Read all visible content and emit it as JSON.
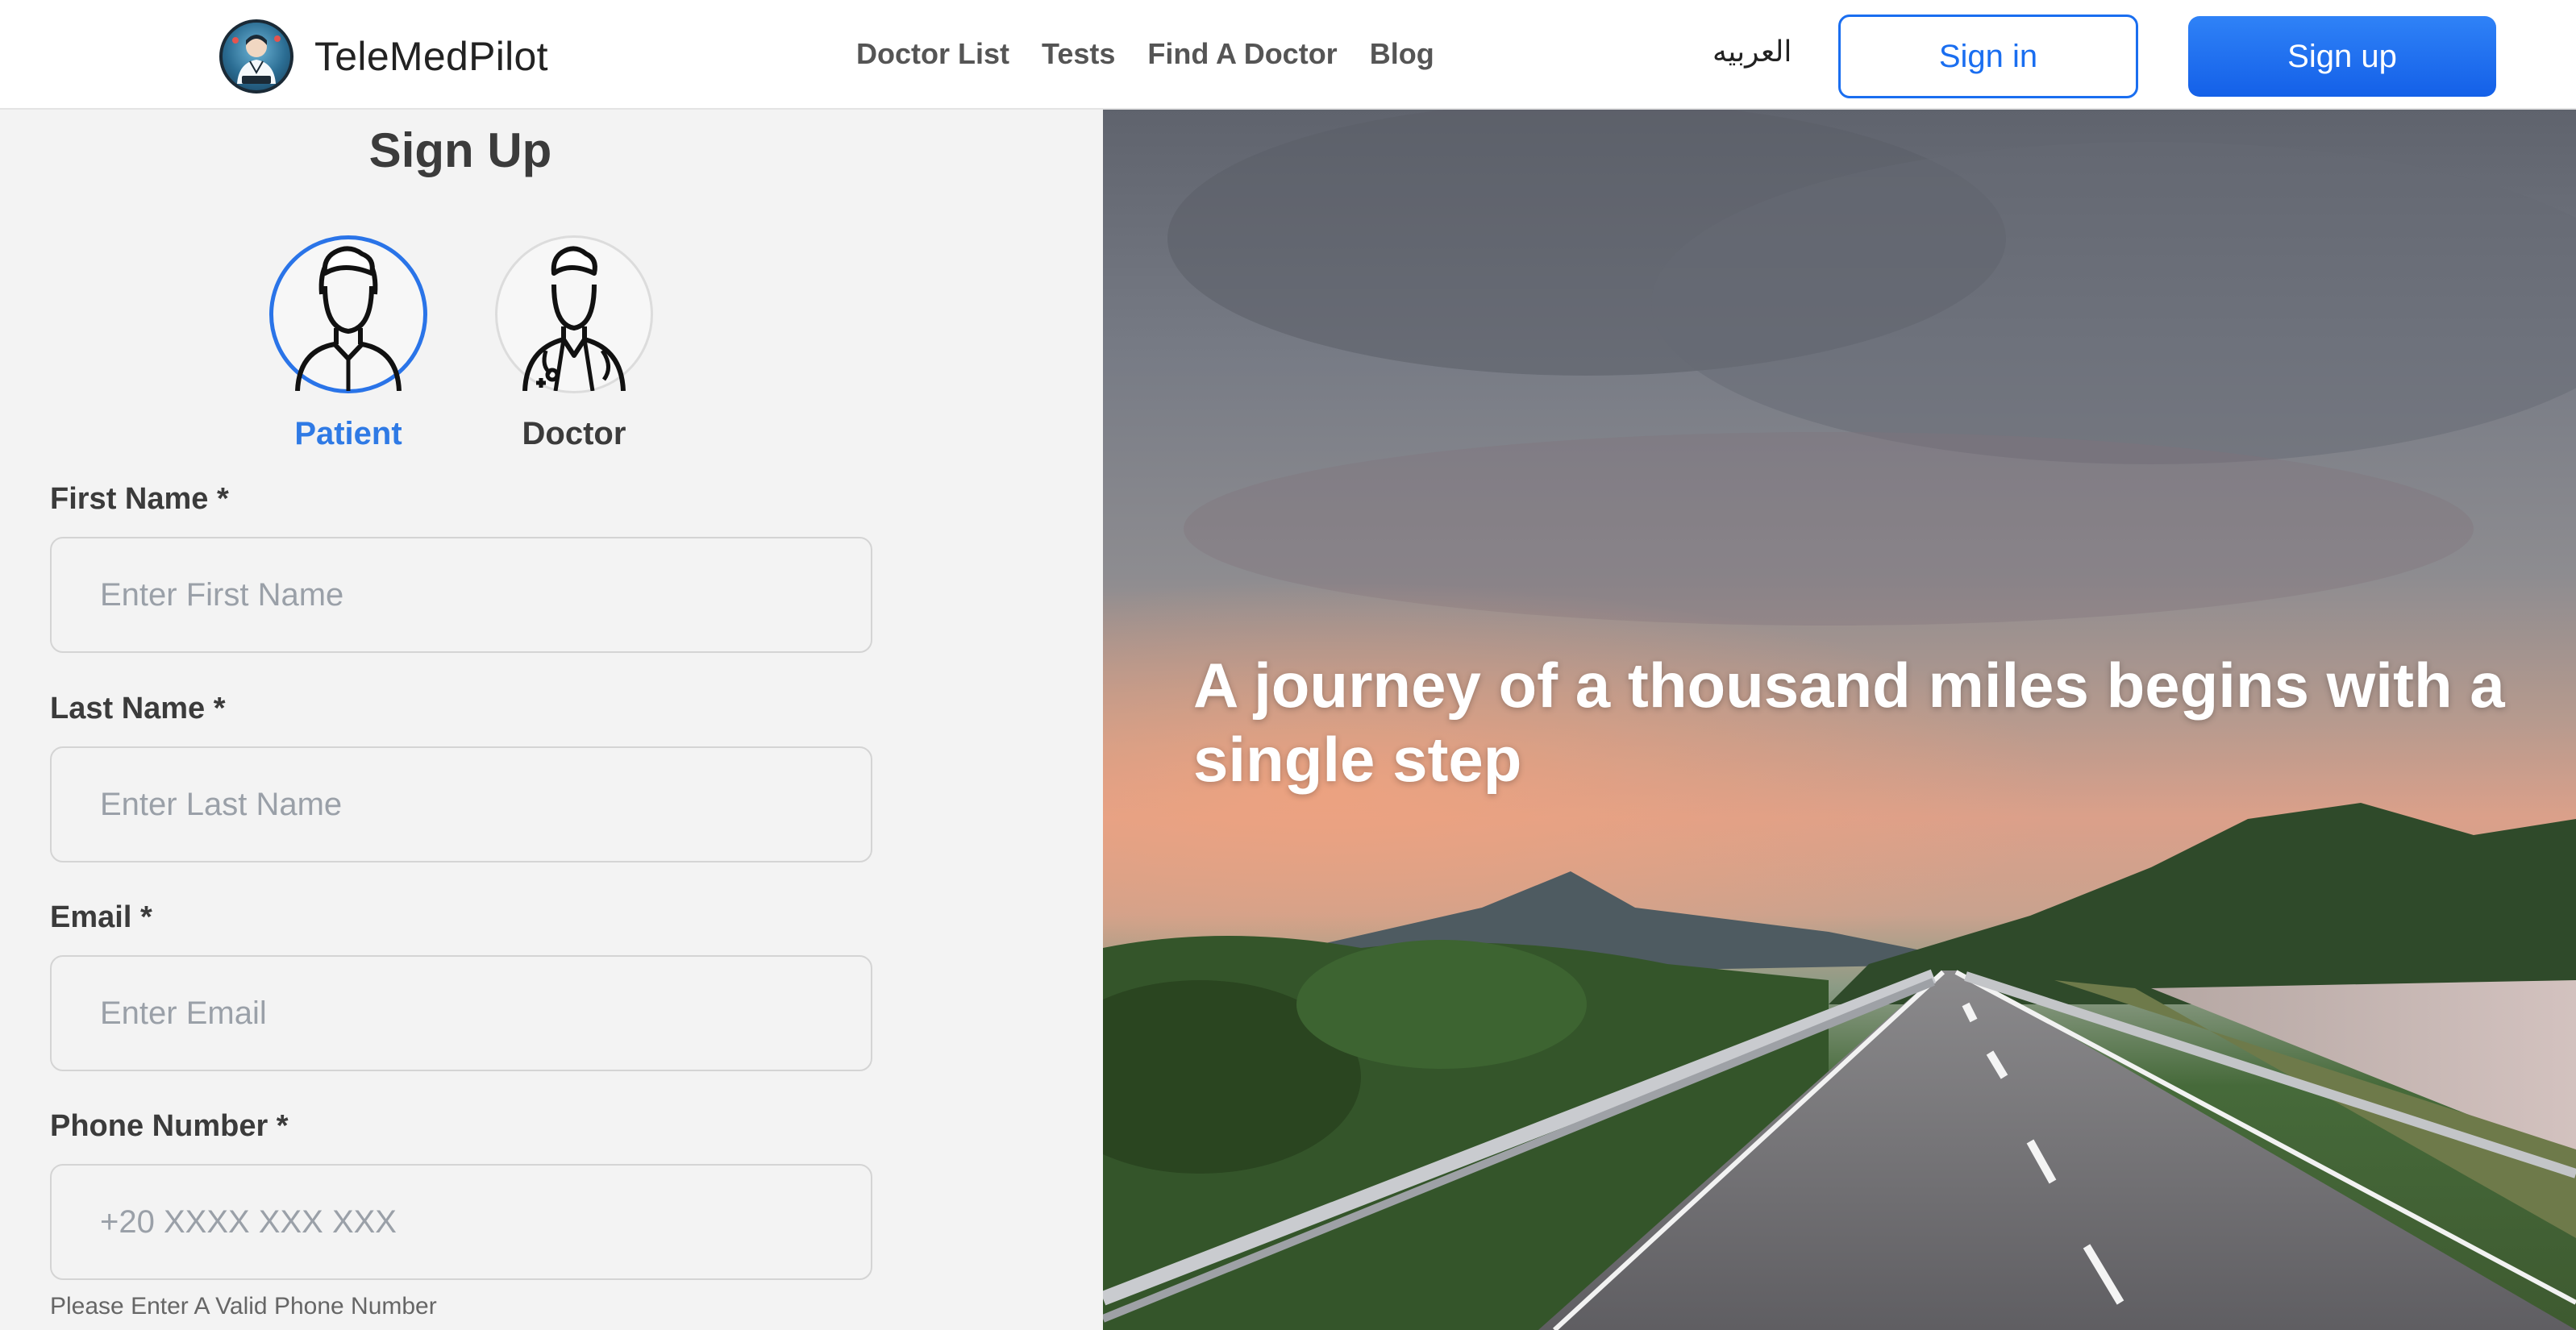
{
  "header": {
    "brand": "TeleMedPilot",
    "nav": [
      "Doctor List",
      "Tests",
      "Find A Doctor",
      "Blog"
    ],
    "language_toggle": "العربيه",
    "signin_label": "Sign in",
    "signup_label": "Sign up"
  },
  "form": {
    "title": "Sign Up",
    "roles": [
      {
        "label": "Patient",
        "icon": "patient-avatar-icon",
        "selected": true
      },
      {
        "label": "Doctor",
        "icon": "doctor-avatar-icon",
        "selected": false
      }
    ],
    "fields": [
      {
        "label": "First Name *",
        "placeholder": "Enter First Name",
        "value": ""
      },
      {
        "label": "Last Name *",
        "placeholder": "Enter Last Name",
        "value": ""
      },
      {
        "label": "Email *",
        "placeholder": "Enter Email",
        "value": ""
      },
      {
        "label": "Phone Number *",
        "placeholder": "+20 XXXX XXX XXX",
        "value": ""
      }
    ],
    "phone_helper": "Please Enter A Valid Phone Number"
  },
  "hero": {
    "quote": "A journey of a thousand miles begins with a single step"
  },
  "colors": {
    "accent": "#1a6ef0",
    "selected_role": "#2f7ae5"
  }
}
